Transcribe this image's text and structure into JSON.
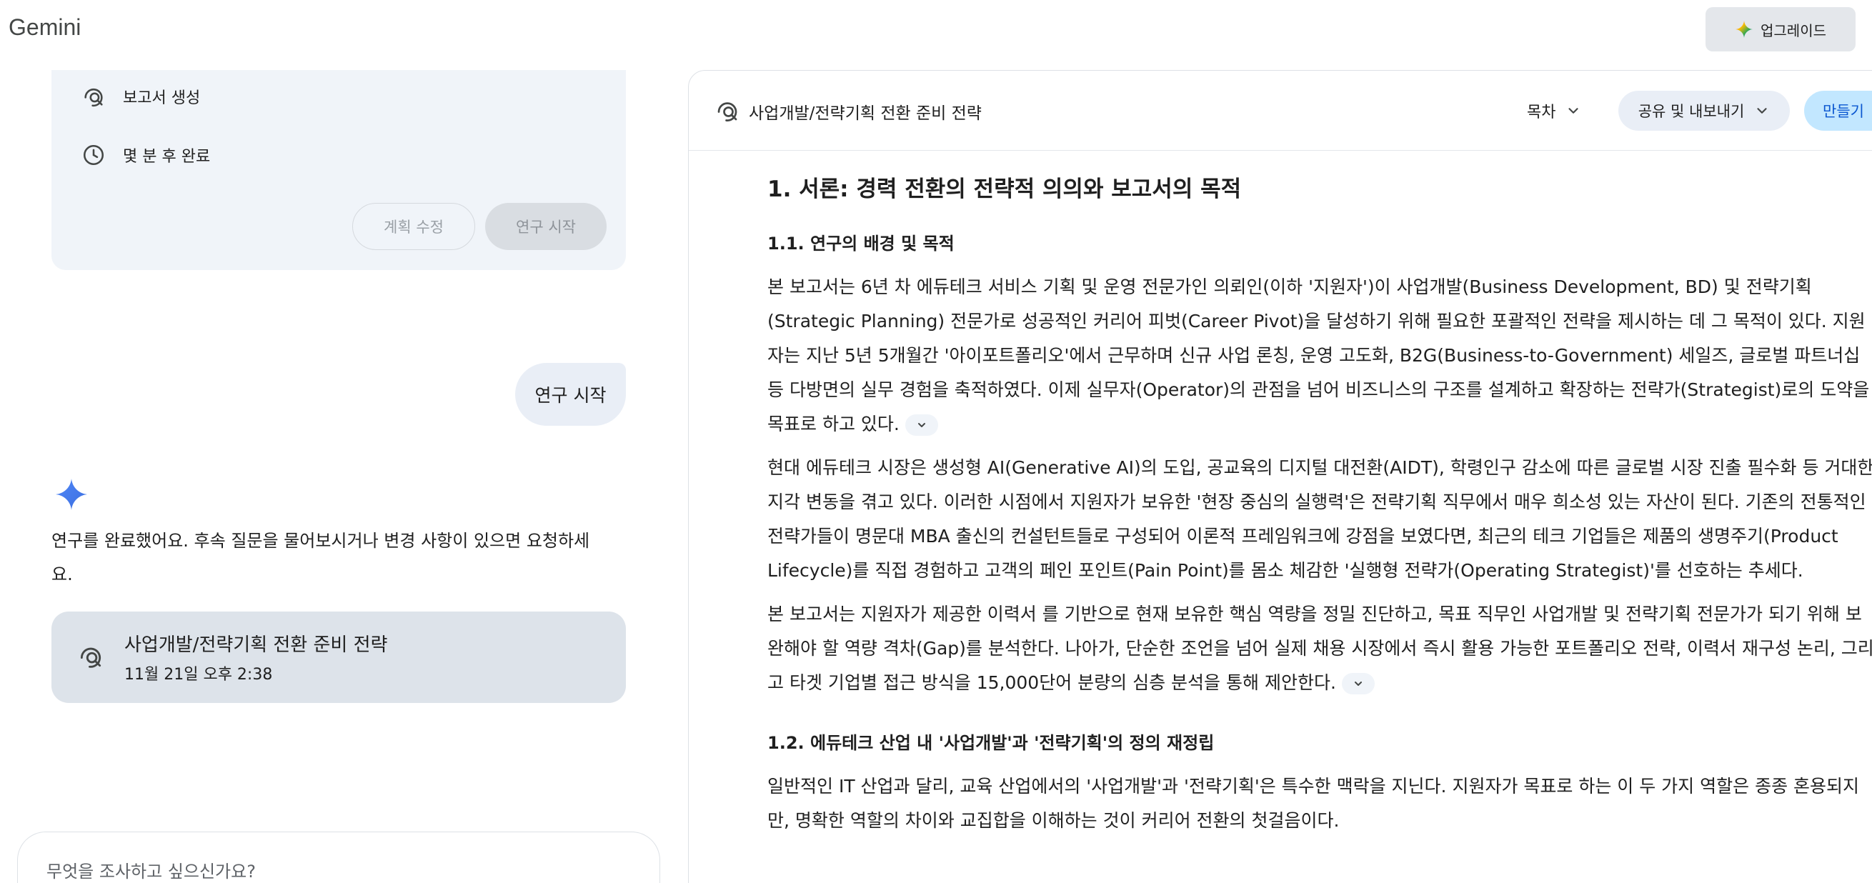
{
  "app": {
    "brand": "Gemini"
  },
  "topbar": {
    "upgrade_label": "업그레이드"
  },
  "plan": {
    "items": [
      {
        "icon": "research-search-icon",
        "label": "보고서 생성"
      },
      {
        "icon": "clock-icon",
        "label": "몇 분 후 완료"
      }
    ],
    "edit_label": "계획 수정",
    "start_label": "연구 시작"
  },
  "chat": {
    "user_message": "연구 시작",
    "reply_lines": [
      "연구를 완료했어요. 후속 질문을 물어보시거나 변경 사항이 있으면 요청하세",
      "요."
    ],
    "doc_card": {
      "title": "사업개발/전략기획 전환 준비 전략",
      "date": "11월 21일 오후 2:38"
    }
  },
  "input": {
    "placeholder": "무엇을 조사하고 싶으신가요?"
  },
  "doc": {
    "title": "사업개발/전략기획 전환 준비 전략",
    "toc_label": "목차",
    "share_label": "공유 및 내보내기",
    "create_label": "만들기",
    "h1": "1. 서론: 경력 전환의 전략적 의의와 보고서의 목적",
    "h2_1": "1.1. 연구의 배경 및 목적",
    "p1": [
      "본 보고서는 6년 차 에듀테크 서비스 기획 및 운영 전문가인 의뢰인(이하 '지원자')이 사업개발(Business Development, BD) 및 전략기획",
      "(Strategic Planning) 전문가로 성공적인 커리어 피벗(Career Pivot)을 달성하기 위해 필요한 포괄적인 전략을 제시하는 데 그 목적이 있다. 지원",
      "자는 지난 5년 5개월간 '아이포트폴리오'에서 근무하며 신규 사업 론칭, 운영 고도화, B2G(Business-to-Government) 세일즈, 글로벌 파트너십",
      "등 다방면의 실무 경험을 축적하였다. 이제 실무자(Operator)의 관점을 넘어 비즈니스의 구조를 설계하고 확장하는 전략가(Strategist)로의 도약을",
      "목표로 하고 있다."
    ],
    "p2": [
      "현대 에듀테크 시장은 생성형 AI(Generative AI)의 도입, 공교육의 디지털 대전환(AIDT), 학령인구 감소에 따른 글로벌 시장 진출 필수화 등 거대한",
      "지각 변동을 겪고 있다. 이러한 시점에서 지원자가 보유한 '현장 중심의 실행력'은 전략기획 직무에서 매우 희소성 있는 자산이 된다. 기존의 전통적인",
      "전략가들이 명문대 MBA 출신의 컨설턴트들로 구성되어 이론적 프레임워크에 강점을 보였다면, 최근의 테크 기업들은 제품의 생명주기(Product",
      "Lifecycle)를 직접 경험하고 고객의 페인 포인트(Pain Point)를 몸소 체감한 '실행형 전략가(Operating Strategist)'를 선호하는 추세다."
    ],
    "p3": [
      "본 보고서는 지원자가 제공한 이력서 를 기반으로 현재 보유한 핵심 역량을 정밀 진단하고, 목표 직무인 사업개발 및 전략기획 전문가가 되기 위해 보",
      "완해야 할 역량 격차(Gap)를 분석한다. 나아가, 단순한 조언을 넘어 실제 채용 시장에서 즉시 활용 가능한 포트폴리오 전략, 이력서 재구성 논리, 그리",
      "고 타겟 기업별 접근 방식을 15,000단어 분량의 심층 분석을 통해 제안한다."
    ],
    "h2_2": "1.2. 에듀테크 산업 내 '사업개발'과 '전략기획'의 정의 재정립",
    "p4": [
      "일반적인 IT 산업과 달리, 교육 산업에서의 '사업개발'과 '전략기획'은 특수한 맥락을 지닌다. 지원자가 목표로 하는 이 두 가지 역할은 종종 혼용되지",
      "만, 명확한 역할의 차이와 교집합을 이해하는 것이 커리어 전환의 첫걸음이다."
    ]
  }
}
